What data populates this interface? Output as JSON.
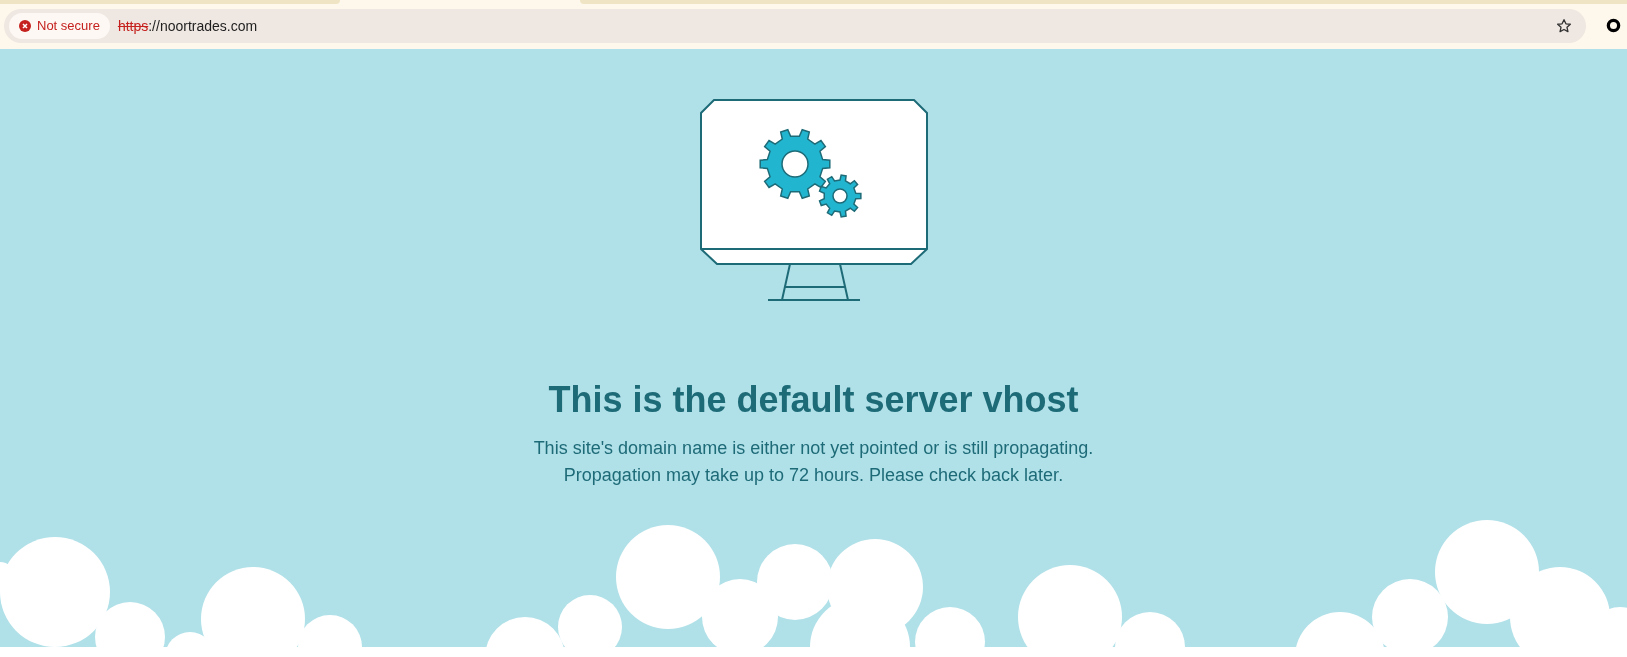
{
  "address_bar": {
    "secure": false,
    "security_label": "Not secure",
    "scheme": "https",
    "rest": "://noortrades.com"
  },
  "page": {
    "heading": "This is the default server vhost",
    "lines": [
      "This site's domain name is either not yet pointed or is still propagating.",
      "Propagation may take up to 72 hours. Please check back later."
    ]
  }
}
